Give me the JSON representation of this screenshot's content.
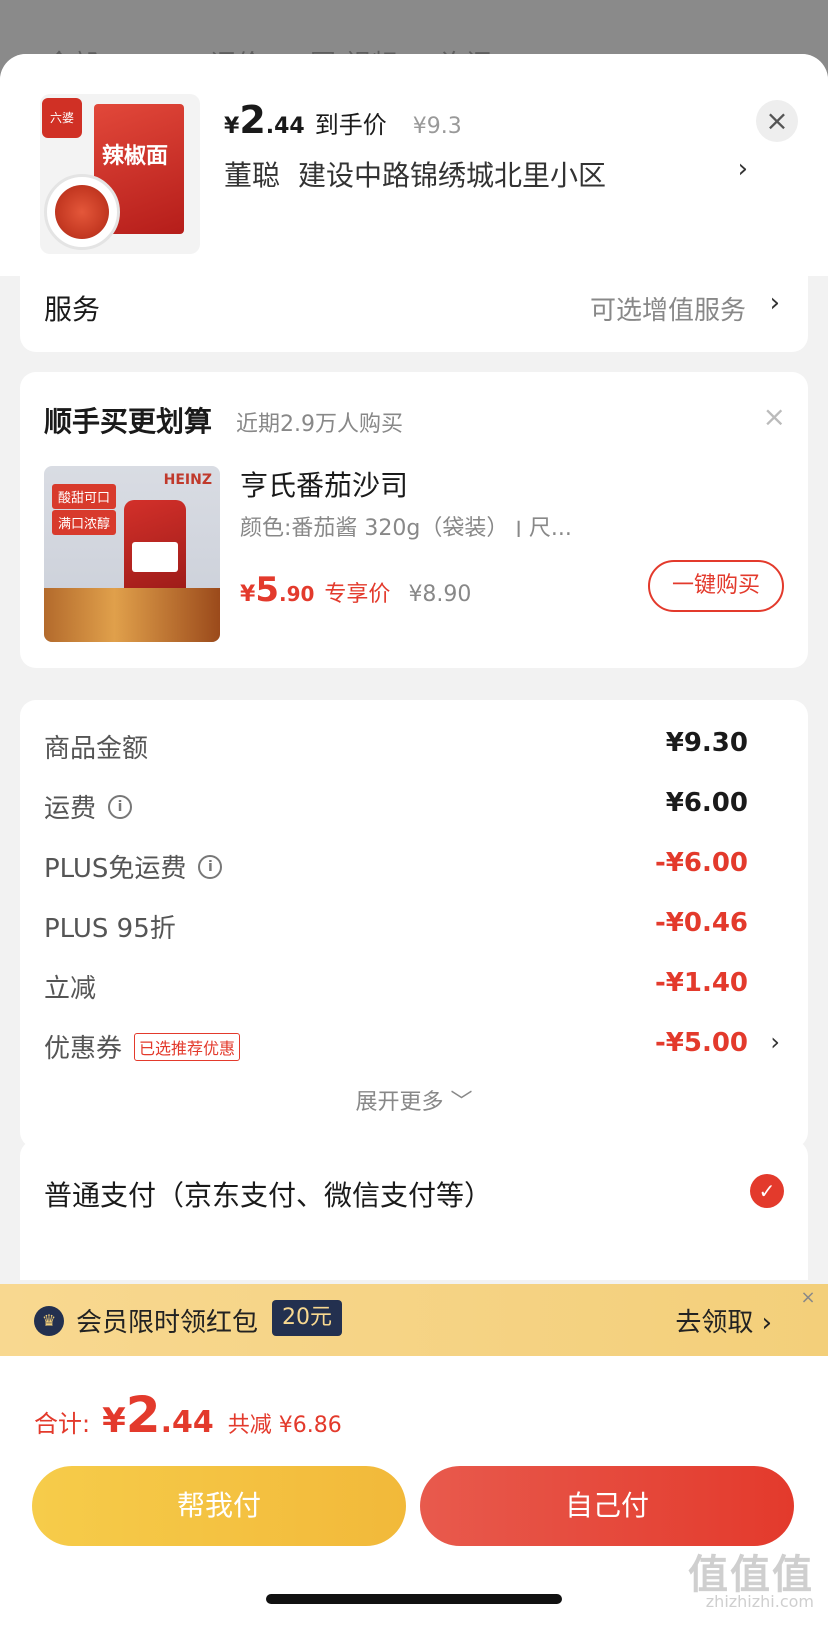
{
  "backdrop": {
    "tabs": [
      "全部",
      "评价",
      "图/视频",
      "询问"
    ]
  },
  "header": {
    "yen": "¥",
    "price_int": "2",
    "price_dec": ".44",
    "price_label": "到手价",
    "original_price": "¥9.3",
    "receiver": "董聪",
    "address": "建设中路锦绣城北里小区",
    "arrow": "›",
    "close": "×",
    "thumb_word": "辣椒面",
    "thumb_logo": "六婆"
  },
  "service": {
    "label": "服务",
    "value": "可选增值服务",
    "arrow": "›"
  },
  "addon": {
    "title": "顺手买更划算",
    "subtitle": "近期2.9万人购买",
    "close": "×",
    "tag1": "酸甜可口",
    "tag2": "满口浓醇",
    "brand": "HEINZ",
    "name": "亨氏番茄沙司",
    "spec": "颜色:番茄酱 320g（袋装）  ׀  尺...",
    "price_yen": "¥",
    "price_int": "5",
    "price_dec": ".90",
    "price_label": "专享价",
    "original_price": "¥8.90",
    "button": "一键购买"
  },
  "totals": {
    "rows": [
      {
        "label": "商品金额",
        "value": "¥9.30"
      },
      {
        "label": "运费",
        "value": "¥6.00"
      },
      {
        "label": "PLUS免运费",
        "value": "-¥6.00"
      },
      {
        "label": "PLUS 95折",
        "value": "-¥0.46"
      },
      {
        "label": "立减",
        "value": "-¥1.40"
      },
      {
        "label": "优惠券",
        "badge": "已选推荐优惠",
        "value": "-¥5.00",
        "arrow": "›"
      }
    ],
    "info_icon": "i",
    "expand": "展开更多 ﹀"
  },
  "payment": {
    "label": "普通支付（京东支付、微信支付等）",
    "check": "✓"
  },
  "banner": {
    "text": "会员限时领红包",
    "amount": "20元",
    "action": "去领取 ›",
    "close": "×",
    "crown": "♛"
  },
  "footer": {
    "sum_label": "合计:",
    "yen": "¥",
    "sum_int": "2",
    "sum_dec": ".44",
    "saved": "共减 ¥6.86",
    "help_pay": "帮我付",
    "self_pay": "自己付"
  },
  "watermark": {
    "text": "值值值",
    "url": "zhizhizhi.com"
  },
  "colors": {
    "accent_red": "#e33a2c",
    "gold": "#f2b93a",
    "navy": "#23304f"
  }
}
